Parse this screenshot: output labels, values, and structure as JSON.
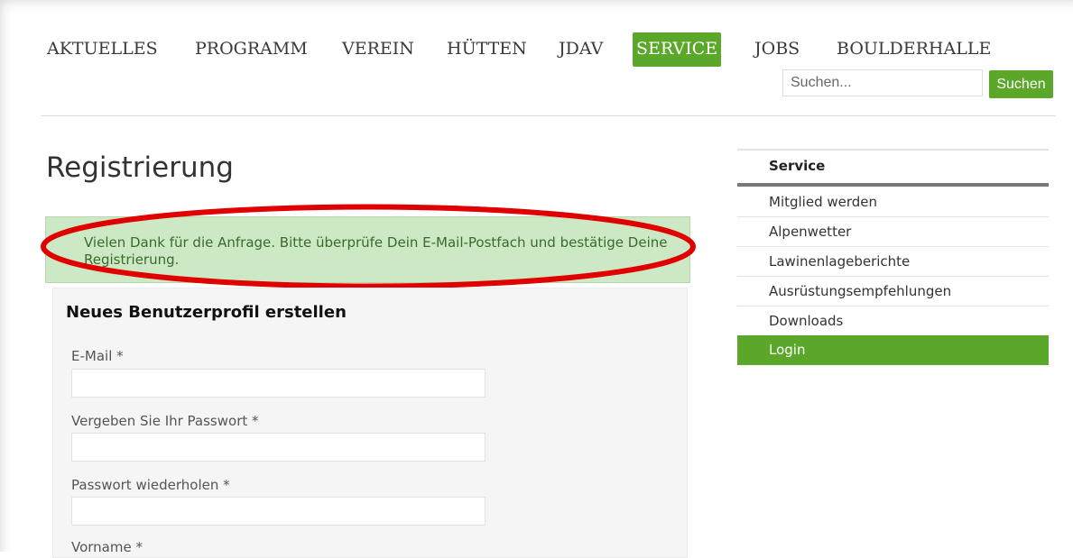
{
  "nav": {
    "items": [
      {
        "label": "AKTUELLES",
        "active": false
      },
      {
        "label": "PROGRAMM",
        "active": false
      },
      {
        "label": "VEREIN",
        "active": false
      },
      {
        "label": "HÜTTEN",
        "active": false
      },
      {
        "label": "JDAV",
        "active": false
      },
      {
        "label": "SERVICE",
        "active": true
      },
      {
        "label": "JOBS",
        "active": false
      },
      {
        "label": "BOULDERHALLE",
        "active": false
      }
    ],
    "active_color": "#5aa72a"
  },
  "search": {
    "placeholder": "Suchen...",
    "button_label": "Suchen"
  },
  "main": {
    "title": "Registrierung",
    "alert_text": "Vielen Dank für die Anfrage. Bitte überprüfe Dein E-Mail-Postfach und bestätige Deine Registrierung.",
    "alert_highlight_color": "#e00000"
  },
  "form": {
    "heading": "Neues Benutzerprofil erstellen",
    "fields": [
      {
        "label": "E-Mail *",
        "value": ""
      },
      {
        "label": "Vergeben Sie Ihr Passwort *",
        "value": ""
      },
      {
        "label": "Passwort wiederholen *",
        "value": ""
      },
      {
        "label": "Vorname *",
        "value": ""
      }
    ]
  },
  "sidebar": {
    "heading": "Service",
    "items": [
      {
        "label": "Mitglied werden",
        "active": false
      },
      {
        "label": "Alpenwetter",
        "active": false
      },
      {
        "label": "Lawinenlageberichte",
        "active": false
      },
      {
        "label": "Ausrüstungsempfehlungen",
        "active": false
      },
      {
        "label": "Downloads",
        "active": false
      },
      {
        "label": "Login",
        "active": true
      }
    ]
  }
}
